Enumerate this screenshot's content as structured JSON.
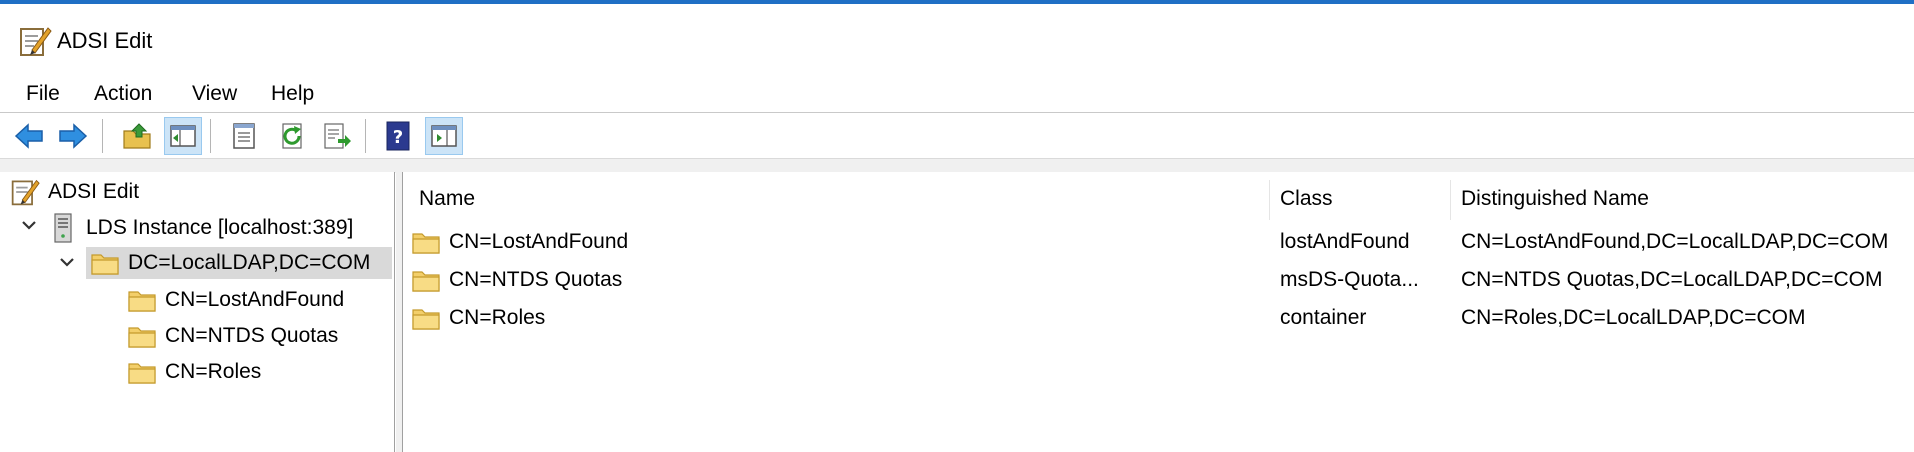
{
  "window": {
    "title": "ADSI Edit",
    "accent_color": "#1f6fc5"
  },
  "menu": {
    "items": [
      {
        "label": "File"
      },
      {
        "label": "Action"
      },
      {
        "label": "View"
      },
      {
        "label": "Help"
      }
    ]
  },
  "toolbar": {
    "buttons": [
      {
        "icon": "back-arrow-icon"
      },
      {
        "icon": "forward-arrow-icon"
      },
      {
        "icon": "up-folder-icon"
      },
      {
        "icon": "show-hide-console-tree-icon",
        "pressed": true
      },
      {
        "icon": "properties-icon"
      },
      {
        "icon": "refresh-icon"
      },
      {
        "icon": "export-list-icon"
      },
      {
        "icon": "help-icon"
      },
      {
        "icon": "show-hide-action-pane-icon",
        "pressed": true
      }
    ]
  },
  "tree": {
    "root": {
      "label": "ADSI Edit",
      "icon": "adsi-edit-icon"
    },
    "instance": {
      "label": "LDS Instance [localhost:389]",
      "icon": "server-icon"
    },
    "dc": {
      "label": "DC=LocalLDAP,DC=COM",
      "icon": "folder-icon"
    },
    "children": [
      {
        "label": "CN=LostAndFound",
        "icon": "folder-icon"
      },
      {
        "label": "CN=NTDS Quotas",
        "icon": "folder-icon"
      },
      {
        "label": "CN=Roles",
        "icon": "folder-icon"
      }
    ]
  },
  "list": {
    "columns": [
      {
        "label": "Name"
      },
      {
        "label": "Class"
      },
      {
        "label": "Distinguished Name"
      }
    ],
    "rows": [
      {
        "name": "CN=LostAndFound",
        "class": "lostAndFound",
        "dn": "CN=LostAndFound,DC=LocalLDAP,DC=COM"
      },
      {
        "name": "CN=NTDS Quotas",
        "class": "msDS-Quota...",
        "dn": "CN=NTDS Quotas,DC=LocalLDAP,DC=COM"
      },
      {
        "name": "CN=Roles",
        "class": "container",
        "dn": "CN=Roles,DC=LocalLDAP,DC=COM"
      }
    ]
  }
}
